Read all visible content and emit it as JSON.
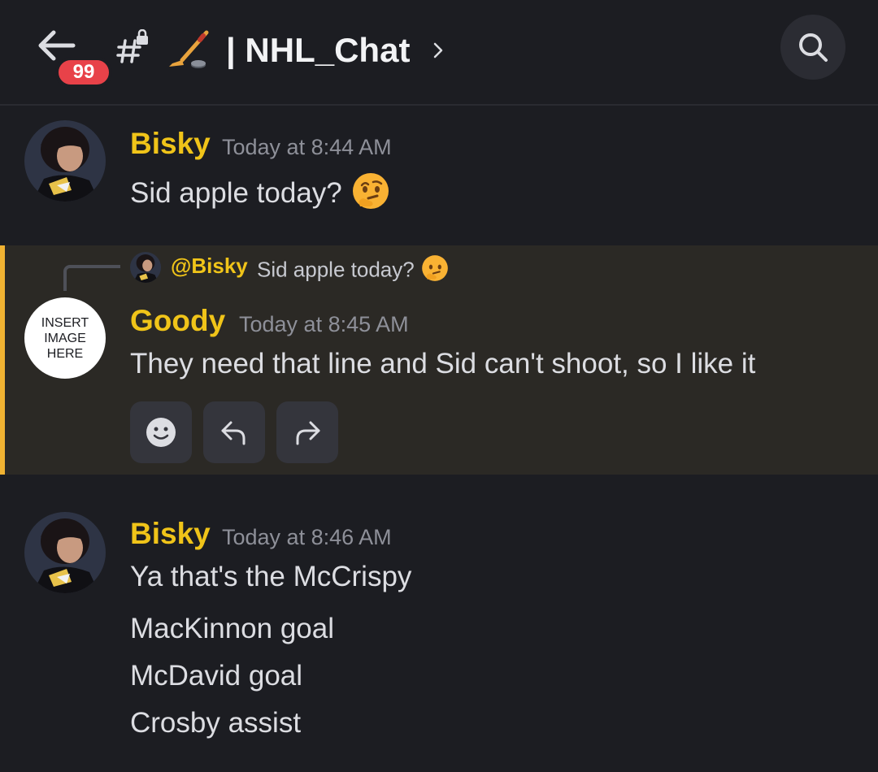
{
  "header": {
    "unread_badge": "99",
    "channel_name": "| NHL_Chat",
    "icons": {
      "back": "arrow-left-icon",
      "channel": "hashtag-lock-icon",
      "channel_emoji": "hockey-stick-icon",
      "chevron": "chevron-right-icon",
      "search": "search-icon"
    }
  },
  "messages": [
    {
      "author": "Bisky",
      "timestamp": "Today at 8:44 AM",
      "lines": [
        "Sid apple today?"
      ],
      "emoji": "thinking-face-icon"
    },
    {
      "reply_to": {
        "mention": "@Bisky",
        "preview": "Sid apple today?",
        "emoji": "thinking-face-icon"
      },
      "avatar_text": [
        "INSERT",
        "IMAGE",
        "HERE"
      ],
      "author": "Goody",
      "timestamp": "Today at 8:45 AM",
      "lines": [
        "They need that line and Sid can't shoot, so I like it"
      ],
      "actions": [
        "smiley-face-icon",
        "reply-icon",
        "forward-icon"
      ]
    },
    {
      "author": "Bisky",
      "timestamp": "Today at 8:46 AM",
      "lines": [
        "Ya that's the McCrispy",
        "MacKinnon goal",
        "McDavid goal",
        "Crosby assist"
      ]
    }
  ],
  "colors": {
    "background": "#1c1d22",
    "author_name": "#f0c419",
    "highlight_bar": "#f0b232",
    "highlight_bg": "#2b2925",
    "badge": "#e84249"
  }
}
